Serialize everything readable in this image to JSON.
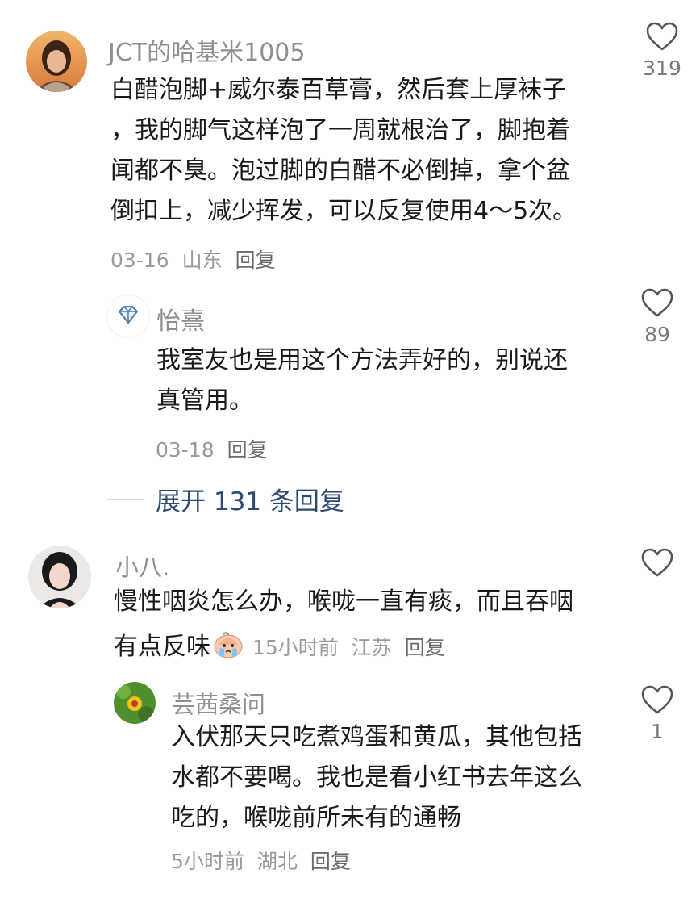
{
  "comments": [
    {
      "name": "JCT的哈基米1005",
      "lines": [
        "白醋泡脚+威尔泰百草膏，然后套上厚袜子",
        "，我的脚气这样泡了一周就根治了，脚抱着",
        "闻都不臭。泡过脚的白醋不必倒掉，拿个盆",
        "倒扣上，减少挥发，可以反复使用4～5次。"
      ],
      "date": "03-16",
      "location": "山东",
      "reply_label": "回复",
      "likes": "319"
    },
    {
      "name": "怡熹",
      "lines": [
        "我室友也是用这个方法弄好的，别说还",
        "真管用。"
      ],
      "date": "03-18",
      "reply_label": "回复",
      "likes": "89"
    },
    {
      "name": "小八.",
      "lines": [
        "慢性咽炎怎么办，喉咙一直有痰，而且吞咽",
        "有点反味"
      ],
      "time": "15小时前",
      "location": "江苏",
      "reply_label": "回复",
      "likes": ""
    },
    {
      "name": "芸茜桑问",
      "lines": [
        "入伏那天只吃煮鸡蛋和黄瓜，其他包括",
        "水都不要喝。我也是看小红书去年这么",
        "吃的，喉咙前所未有的通畅"
      ],
      "time": "5小时前",
      "location": "湖北",
      "reply_label": "回复",
      "likes": "1"
    }
  ],
  "expand": {
    "label": "展开 131 条回复"
  },
  "colors": {
    "link_blue": "#2d4a75",
    "meta_gray": "#9a9a9a",
    "name_gray": "#8f8f8f"
  }
}
